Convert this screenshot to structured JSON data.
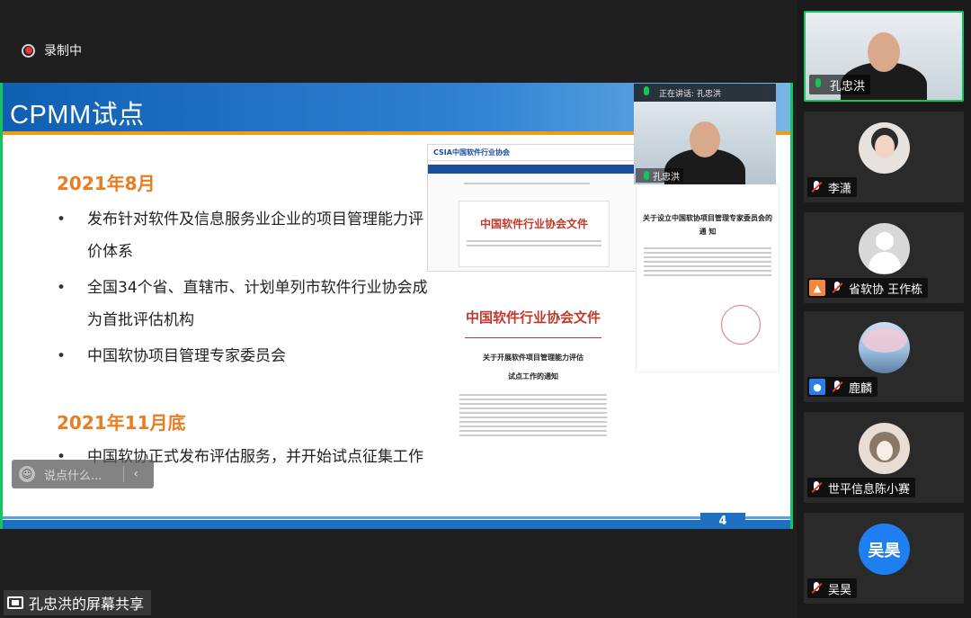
{
  "recording": {
    "label": "录制中"
  },
  "slide": {
    "title_latin": "CPMM",
    "title_cn": "试点",
    "page_number": "4",
    "sections": [
      {
        "year": "2021年8月",
        "bullets": [
          "发布针对软件及信息服务业企业的项目管理能力评价体系",
          "全国34个省、直辖市、计划单列市软件行业协会成为首批评估机构",
          "中国软协项目管理专家委员会"
        ]
      },
      {
        "year": "2021年11月底",
        "bullets": [
          "中国软协正式发布评估服务，并开始试点征集工作"
        ]
      }
    ],
    "doc_a": {
      "logo": "CSIA中国软件行业协会",
      "heading": "中国软件行业协会文件"
    },
    "doc_b": {
      "heading": "中国软件行业协会文件",
      "subtitle1": "关于开展软件项目管理能力评估",
      "subtitle2": "试点工作的通知"
    },
    "doc_c": {
      "subtitle1": "关于设立中国软协项目管理专家委员会的",
      "subtitle2": "通 知"
    }
  },
  "speaker": {
    "bar_label": "正在讲话: 孔忠洪",
    "name": "孔忠洪"
  },
  "comment": {
    "placeholder": "说点什么..."
  },
  "share": {
    "label": "孔忠洪的屏幕共享"
  },
  "participants": [
    {
      "name": "孔忠洪",
      "mic": "on",
      "active": true
    },
    {
      "name": "李潇",
      "mic": "muted"
    },
    {
      "name": "省软协 王作栋",
      "mic": "muted",
      "tag": "orange"
    },
    {
      "name": "鹿麟",
      "mic": "muted",
      "tag": "blue"
    },
    {
      "name": "世平信息陈小赛",
      "mic": "muted"
    },
    {
      "name": "吴昊",
      "mic": "muted",
      "avatar_text": "吴昊"
    }
  ],
  "colors": {
    "accent_green": "#16c45f",
    "heading_orange": "#e67e22",
    "slide_blue": "#1f6fc1"
  }
}
